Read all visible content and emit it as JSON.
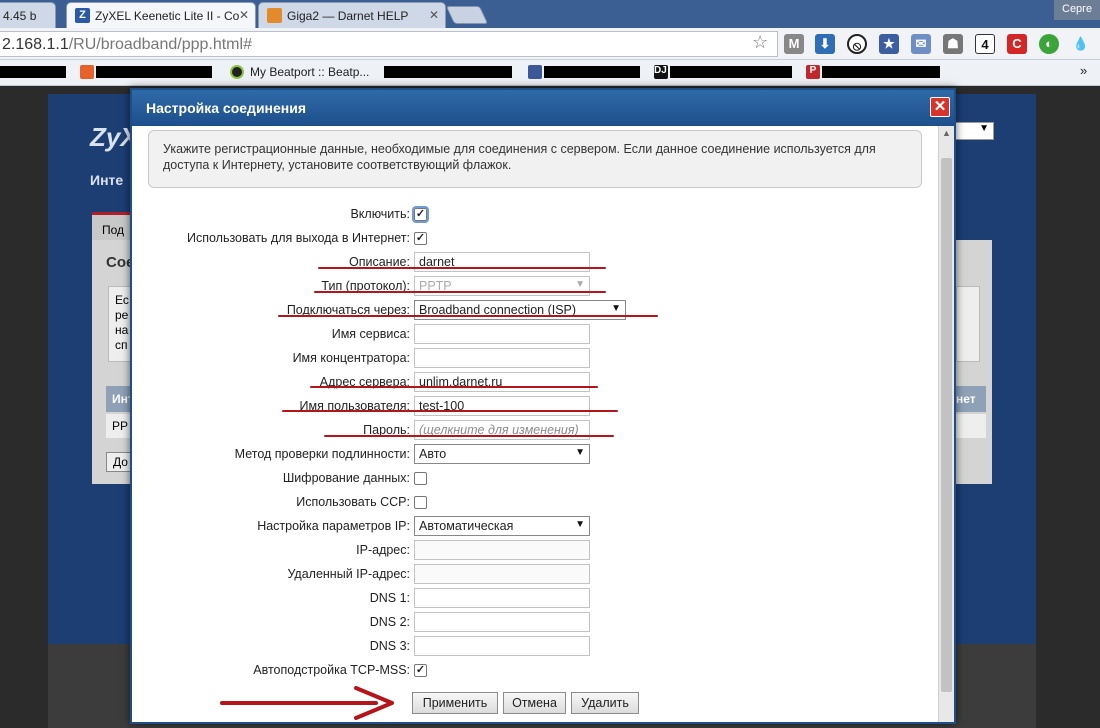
{
  "browser": {
    "tabs": [
      {
        "title": "4.45 b",
        "favicon_color": "#7d8fa9",
        "active": false
      },
      {
        "title": "ZyXEL Keenetic Lite II - Co",
        "favicon_color": "#2a5aa5",
        "active": true
      },
      {
        "title": "Giga2 — Darnet HELP",
        "favicon_color": "#e38a2a",
        "active": false
      }
    ],
    "user_label": "Серге",
    "url_host": "2.168.1.1",
    "url_path": "/RU/broadband/ppp.html#",
    "bookmarks": {
      "beatport": "My Beatport :: Beatp..."
    }
  },
  "background_page": {
    "logo": "ZyX",
    "subtitle": "Инте",
    "tab": "Под",
    "heading": "Сое",
    "box_text": "Ес ре на сп",
    "table_head": "Инт",
    "table_head_right": "нет",
    "table_cell": "PP",
    "button": "До"
  },
  "dialog": {
    "title": "Настройка соединения",
    "close_glyph": "✕",
    "note": "Укажите регистрационные данные, необходимые для соединения с сервером. Если данное соединение используется для доступа к Интернету, установите соответствующий флажок.",
    "fields": {
      "enable": {
        "label": "Включить:",
        "checked": "✓"
      },
      "internet": {
        "label": "Использовать для выхода в Интернет:",
        "checked": "✓"
      },
      "description": {
        "label": "Описание:",
        "value": "darnet"
      },
      "protocol": {
        "label": "Тип (протокол):",
        "value": "PPTP"
      },
      "connect_via": {
        "label": "Подключаться через:",
        "value": "Broadband connection (ISP)"
      },
      "service_name": {
        "label": "Имя сервиса:",
        "value": ""
      },
      "concentrator": {
        "label": "Имя концентратора:",
        "value": ""
      },
      "server": {
        "label": "Адрес сервера:",
        "value": "unlim.darnet.ru"
      },
      "username": {
        "label": "Имя пользователя:",
        "value": "test-100"
      },
      "password": {
        "label": "Пароль:",
        "placeholder": "(щелкните для изменения)"
      },
      "auth_method": {
        "label": "Метод проверки подлинности:",
        "value": "Авто"
      },
      "encryption": {
        "label": "Шифрование данных:"
      },
      "ccp": {
        "label": "Использовать CCP:"
      },
      "ip_settings": {
        "label": "Настройка параметров IP:",
        "value": "Автоматическая"
      },
      "ip_address": {
        "label": "IP-адрес:",
        "value": ""
      },
      "remote_ip": {
        "label": "Удаленный IP-адрес:",
        "value": ""
      },
      "dns1": {
        "label": "DNS 1:",
        "value": ""
      },
      "dns2": {
        "label": "DNS 2:",
        "value": ""
      },
      "dns3": {
        "label": "DNS 3:",
        "value": ""
      },
      "tcp_mss": {
        "label": "Автоподстройка TCP-MSS:",
        "checked": "✓"
      }
    },
    "buttons": {
      "apply": "Применить",
      "cancel": "Отмена",
      "delete": "Удалить"
    },
    "annotation_color": "#b5141a"
  }
}
